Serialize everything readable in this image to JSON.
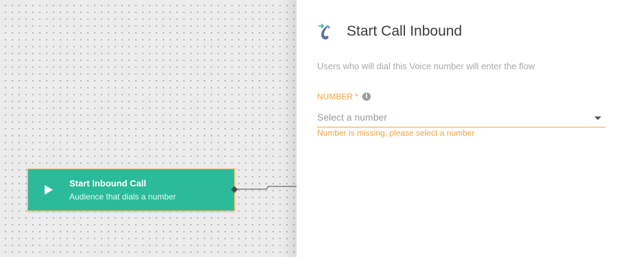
{
  "canvas": {
    "node": {
      "title": "Start Inbound Call",
      "subtitle": "Audience that dials a number",
      "icon": "play-icon",
      "color": "#2bbb9a",
      "border_color": "#f0b95a"
    }
  },
  "panel": {
    "icon": "inbound-call-icon",
    "title": "Start Call Inbound",
    "description": "Users who will dial this Voice number will enter the flow",
    "number_field": {
      "label": "NUMBER *",
      "info_icon": "info-icon",
      "placeholder": "Select a number",
      "error": "Number is missing, please select a number",
      "accent_color": "#f0a43a"
    }
  }
}
